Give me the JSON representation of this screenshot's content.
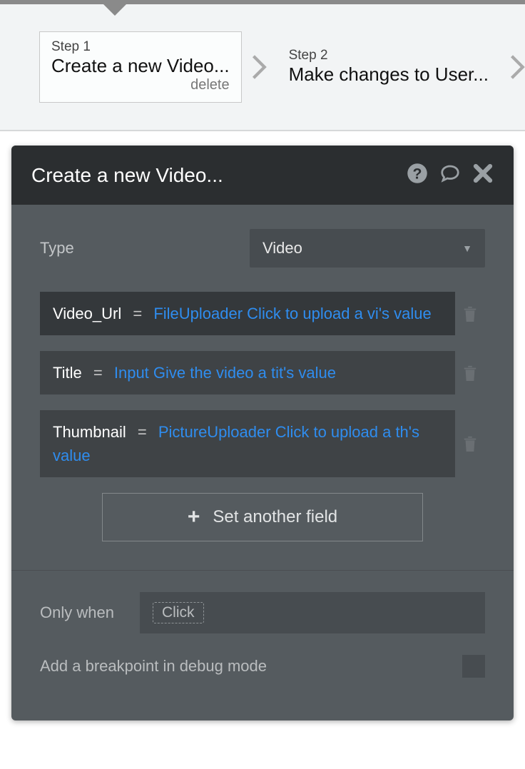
{
  "steps": [
    {
      "num": "Step 1",
      "title": "Create a new Video...",
      "delete": "delete"
    },
    {
      "num": "Step 2",
      "title": "Make changes to User..."
    }
  ],
  "panel": {
    "title": "Create a new Video...",
    "type_label": "Type",
    "type_value": "Video",
    "fields": [
      {
        "key": "Video_Url",
        "eq": "=",
        "val": "FileUploader Click to upload a vi's value",
        "hl": true
      },
      {
        "key": "Title",
        "eq": "=",
        "val": "Input Give the video a tit's value",
        "hl": false
      },
      {
        "key": "Thumbnail",
        "eq": "=",
        "val": "PictureUploader Click to upload a th's value",
        "hl": false
      }
    ],
    "set_another": "Set another field",
    "only_when_label": "Only when",
    "only_when_token": "Click",
    "breakpoint_label": "Add a breakpoint in debug mode"
  }
}
